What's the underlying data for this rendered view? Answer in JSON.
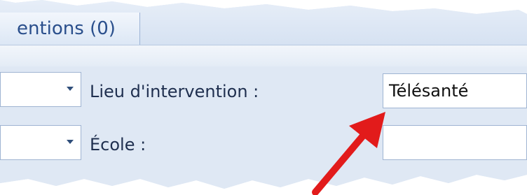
{
  "tabs": {
    "active_label": "entions (0)"
  },
  "form": {
    "lieu_label": "Lieu d'intervention :",
    "lieu_value": "Télésanté",
    "ecole_label": "École :",
    "ecole_value": ""
  },
  "colors": {
    "tab_text": "#2a4f8c",
    "annotation_arrow": "#e21b1b"
  },
  "icons": {
    "combo_dropdown": "chevron-down-icon",
    "annotation": "red-arrow-icon"
  }
}
